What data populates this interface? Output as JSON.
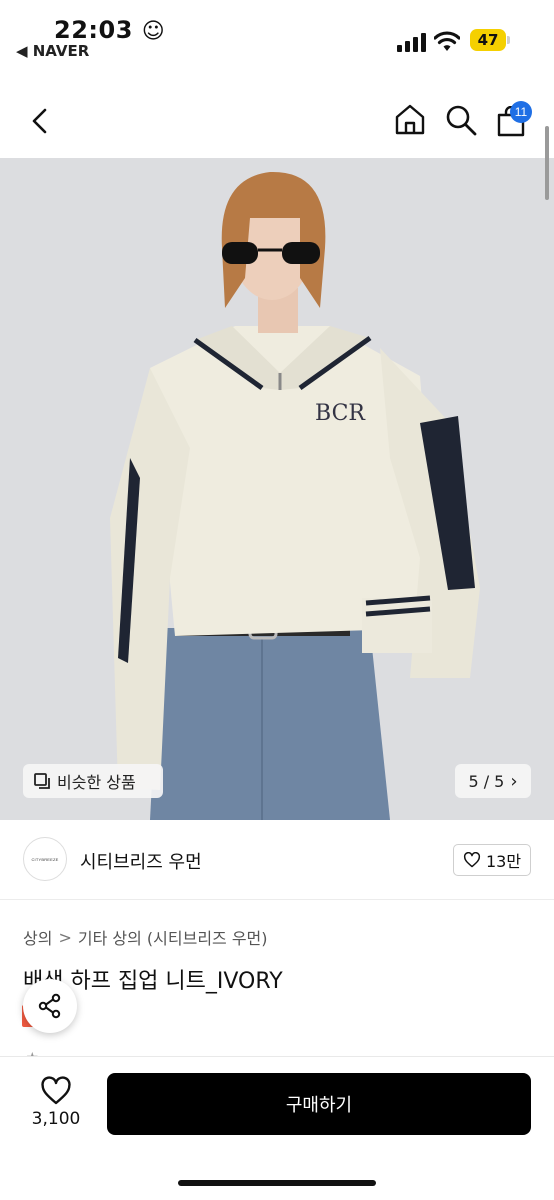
{
  "status_bar": {
    "time": "22:03",
    "time_emoji": "☺",
    "back_app": "◀ NAVER",
    "battery": "47"
  },
  "header": {
    "icons": [
      "back-icon",
      "home-icon",
      "search-icon",
      "cart-icon"
    ],
    "cart_badge": "11"
  },
  "hero": {
    "similar_label": "비슷한 상품",
    "counter": "5 / 5",
    "counter_chevron": "›"
  },
  "brand": {
    "logo_text": "CITYBREEZE",
    "name": "시티브리즈 우먼",
    "likes": "13만"
  },
  "product": {
    "breadcrumb": [
      "상의",
      "기타 상의 (시티브리즈 우먼)"
    ],
    "breadcrumb_sep": ">",
    "title": "배색 하프 집업 니트_IVORY",
    "sale_tag": "세일"
  },
  "bottom_bar": {
    "wish_count": "3,100",
    "buy_label": "구매하기"
  },
  "colors": {
    "accent_blue": "#1f6fe5",
    "sale_red": "#f05a40",
    "buy_black": "#000000"
  }
}
